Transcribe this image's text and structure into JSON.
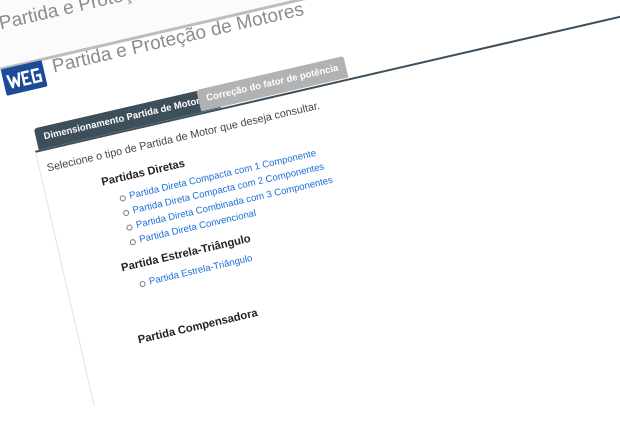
{
  "header": {
    "title": "Partida e Proteção de Motores",
    "subtitle": "Partida e Proteção de Motores",
    "logo_text": "WEG"
  },
  "tabs": [
    {
      "label": "Dimensionamento Partida de Motores",
      "active": true
    },
    {
      "label": "Correção do fator de potência",
      "active": false
    }
  ],
  "content": {
    "instruction": "Selecione o tipo de Partida de Motor que deseja consultar.",
    "sections": [
      {
        "heading": "Partidas Diretas",
        "links": [
          "Partida Direta Compacta com 1 Componente",
          "Partida Direta Compacta com 2 Componentes",
          "Partida Direta Combinada com 3 Componentes",
          "Partida Direta Convencional"
        ]
      },
      {
        "heading": "Partida Estrela-Triângulo",
        "links": [
          "Partida Estrela-Triângulo"
        ]
      },
      {
        "heading": "Partida Compensadora"
      }
    ]
  },
  "colors": {
    "tab_active": "#3e4f5c",
    "tab_inactive": "#b2b2b2",
    "link": "#1a6fd8",
    "logo": "#1c4b97",
    "header_text": "#8c8c8c"
  }
}
